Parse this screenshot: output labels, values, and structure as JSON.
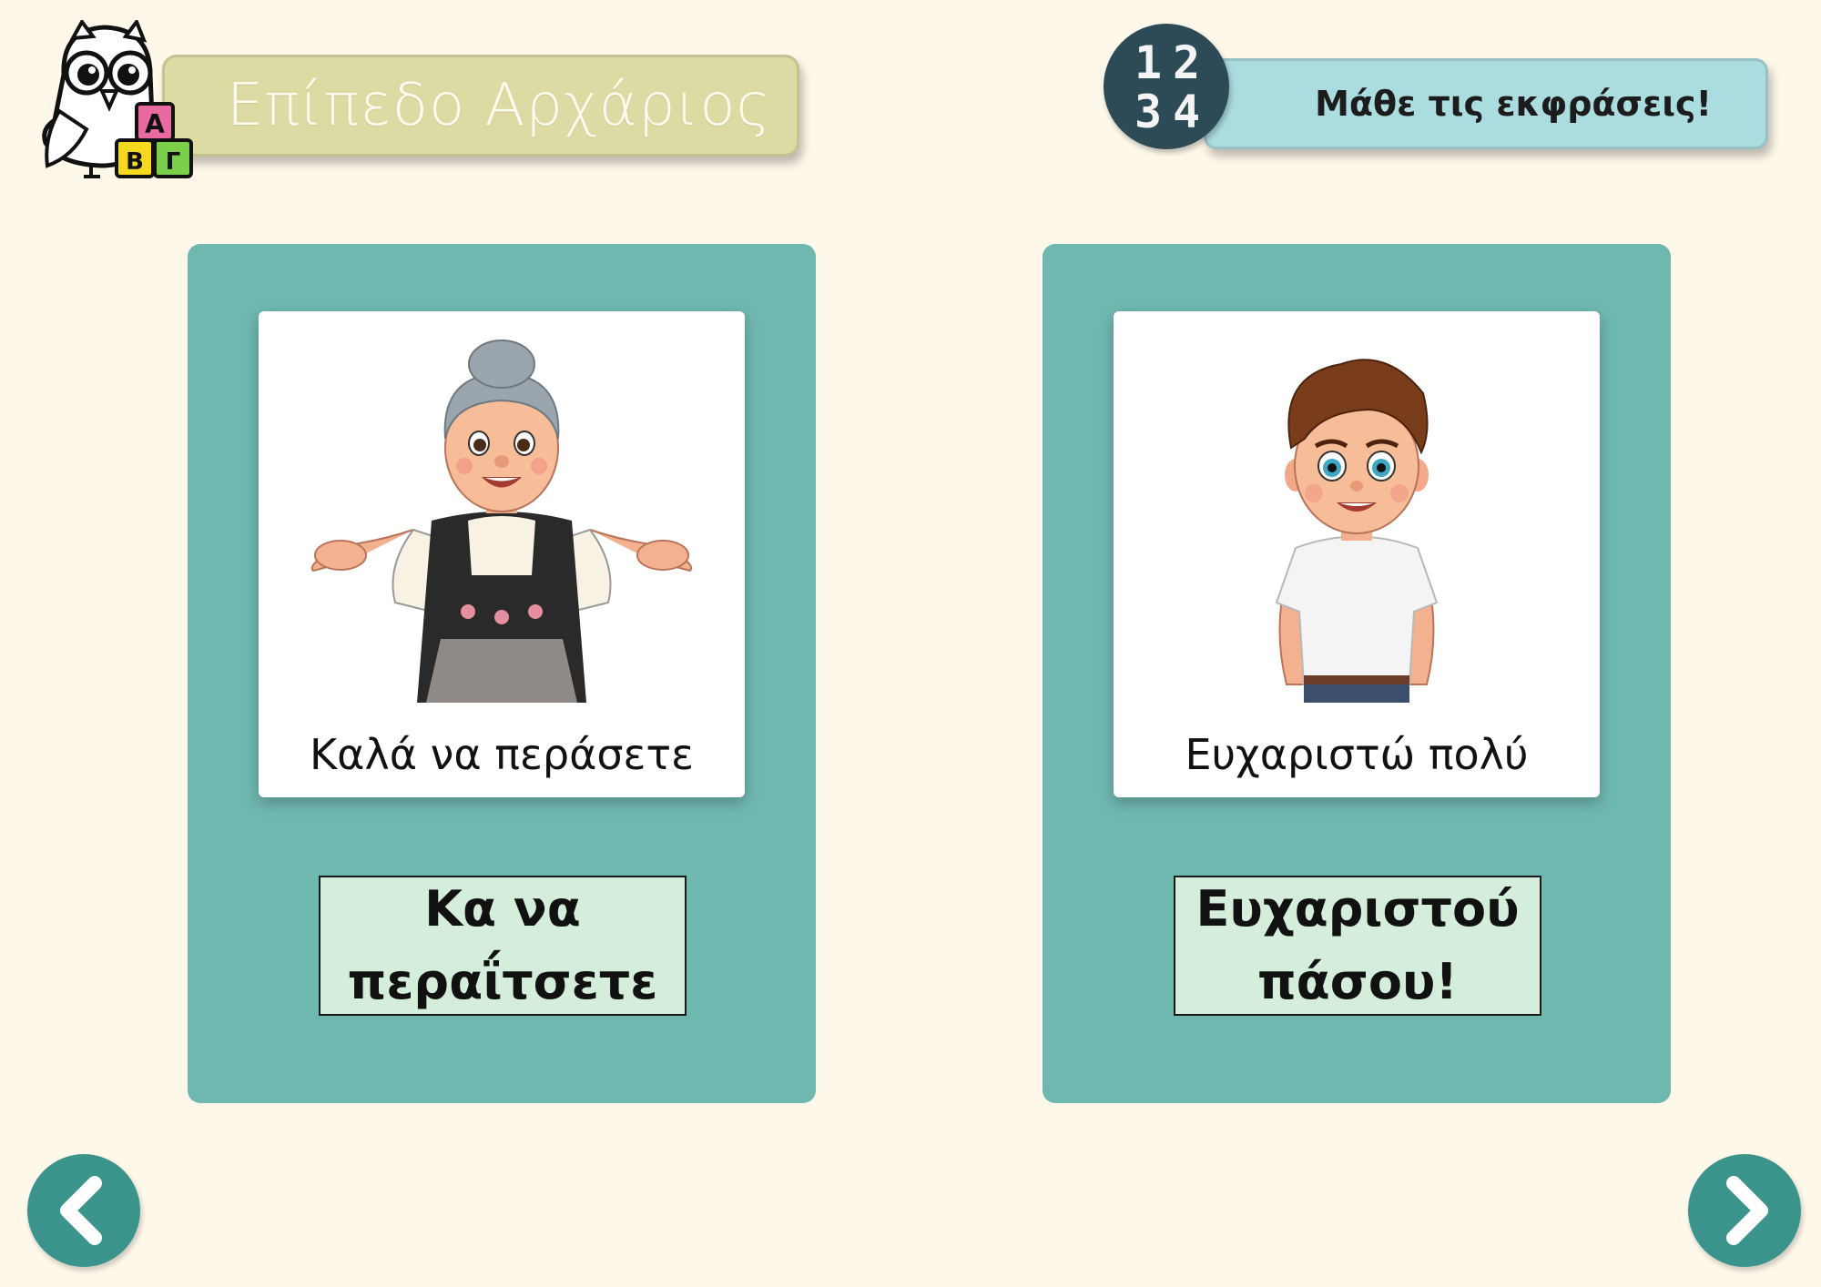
{
  "header": {
    "level_title": "Επίπεδο Αρχάριος",
    "expressions_title": "Μάθε τις εκφράσεις!",
    "numbers_badge": [
      "1",
      "2",
      "3",
      "4"
    ],
    "logo_blocks": [
      "Α",
      "Β",
      "Γ"
    ]
  },
  "cards": [
    {
      "caption": "Καλά να περάσετε",
      "answer_line1": "Κα να",
      "answer_line2": "περαΐτσετε",
      "image_icon": "grandmother-illustration"
    },
    {
      "caption": "Ευχαριστώ πολύ",
      "answer_line1": "Ευχαριστού",
      "answer_line2": "πάσου!",
      "image_icon": "boy-illustration"
    }
  ],
  "navigation": {
    "prev_icon": "chevron-left-icon",
    "next_icon": "chevron-right-icon"
  },
  "colors": {
    "background": "#fdf8ea",
    "card": "#6fb8b0",
    "answer_box": "#d4eedb",
    "level_banner": "#dcdba3",
    "expressions_banner": "#abdce0",
    "nav_button": "#3a948c"
  }
}
